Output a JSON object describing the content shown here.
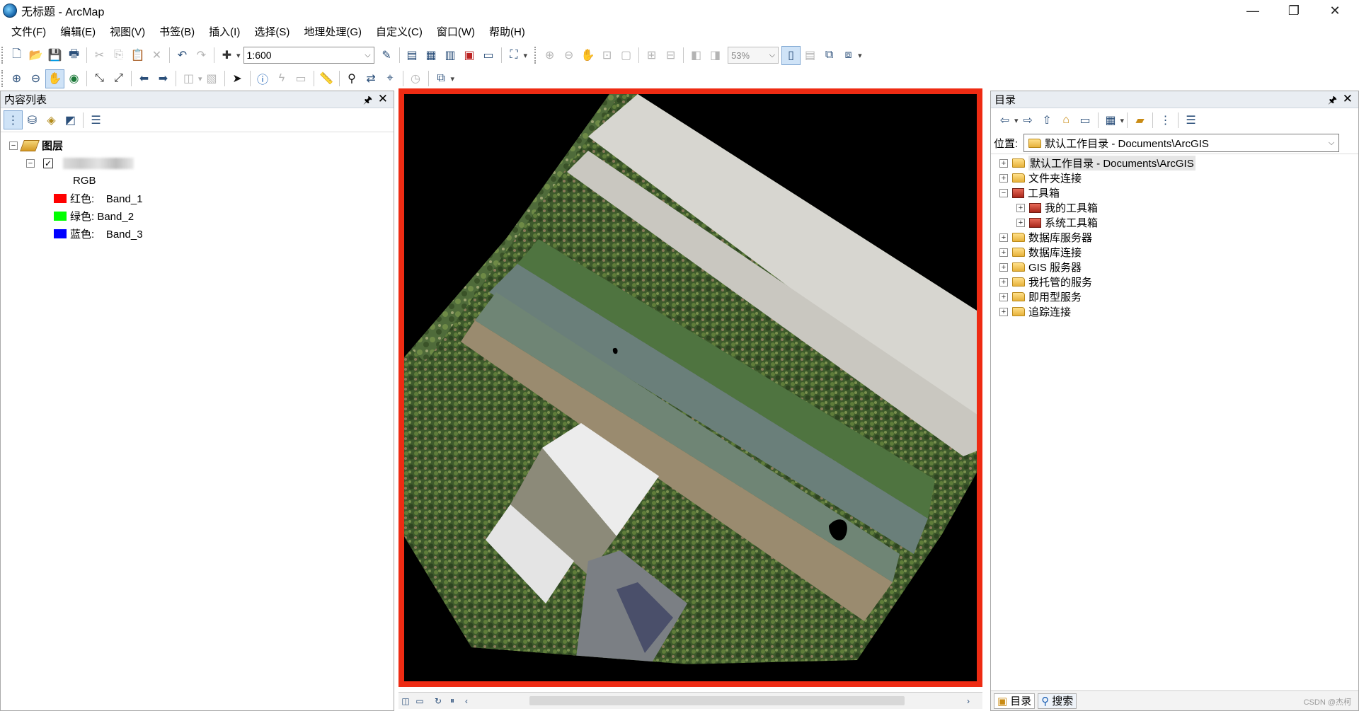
{
  "window": {
    "title": "无标题 - ArcMap",
    "controls": {
      "minimize": "—",
      "maximize": "❐",
      "close": "✕"
    }
  },
  "menu": [
    "文件(F)",
    "编辑(E)",
    "视图(V)",
    "书签(B)",
    "插入(I)",
    "选择(S)",
    "地理处理(G)",
    "自定义(C)",
    "窗口(W)",
    "帮助(H)"
  ],
  "toolbar": {
    "scale_value": "1:600",
    "zoom_value": "53%"
  },
  "toc": {
    "title": "内容列表",
    "root_label": "图层",
    "layer_render": "RGB",
    "bands": [
      {
        "label": "红色:    Band_1",
        "color": "#ff0000"
      },
      {
        "label": "绿色: Band_2",
        "color": "#00ff00"
      },
      {
        "label": "蓝色:    Band_3",
        "color": "#0000ff"
      }
    ]
  },
  "catalog": {
    "title": "目录",
    "location_label": "位置:",
    "location_value": "默认工作目录 - Documents\\ArcGIS",
    "items": [
      {
        "label": "默认工作目录 - Documents\\ArcGIS",
        "level": 0,
        "expander": "+",
        "icon": "folder-home-icon",
        "selected": true
      },
      {
        "label": "文件夹连接",
        "level": 0,
        "expander": "+",
        "icon": "folder-icon"
      },
      {
        "label": "工具箱",
        "level": 0,
        "expander": "−",
        "icon": "toolbox-icon"
      },
      {
        "label": "我的工具箱",
        "level": 1,
        "expander": "+",
        "icon": "toolbox-icon"
      },
      {
        "label": "系统工具箱",
        "level": 1,
        "expander": "+",
        "icon": "toolbox-icon"
      },
      {
        "label": "数据库服务器",
        "level": 0,
        "expander": "+",
        "icon": "database-server-icon"
      },
      {
        "label": "数据库连接",
        "level": 0,
        "expander": "+",
        "icon": "database-connection-icon"
      },
      {
        "label": "GIS 服务器",
        "level": 0,
        "expander": "+",
        "icon": "gis-server-icon"
      },
      {
        "label": "我托管的服务",
        "level": 0,
        "expander": "+",
        "icon": "hosted-services-icon"
      },
      {
        "label": "即用型服务",
        "level": 0,
        "expander": "+",
        "icon": "ready-services-icon"
      },
      {
        "label": "追踪连接",
        "level": 0,
        "expander": "+",
        "icon": "tracking-connection-icon"
      }
    ],
    "tabs": [
      "目录",
      "搜索"
    ]
  },
  "watermark": "CSDN @杰柯",
  "colors": {
    "map_border": "#ee2b13",
    "panel_header": "#e9edf2"
  }
}
